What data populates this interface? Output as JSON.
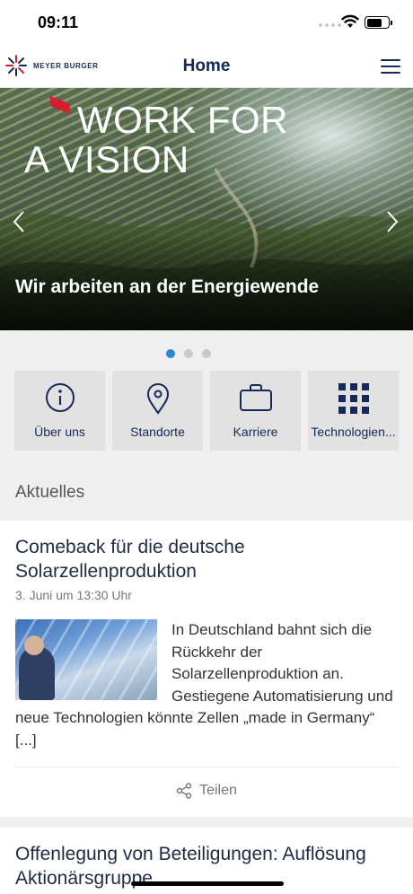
{
  "status_bar": {
    "time": "09:11"
  },
  "header": {
    "logo_text": "MEYER BURGER",
    "title": "Home"
  },
  "hero": {
    "headline_line1": "WORK FOR",
    "headline_line2": "A VISION",
    "caption": "Wir arbeiten an der Energiewende",
    "slide_count": 3,
    "active_slide": 1
  },
  "tiles": [
    {
      "label": "Über uns",
      "icon": "info-icon"
    },
    {
      "label": "Standorte",
      "icon": "location-pin-icon"
    },
    {
      "label": "Karriere",
      "icon": "briefcase-icon"
    },
    {
      "label": "Technologien...",
      "icon": "grid-icon"
    }
  ],
  "news": {
    "section_title": "Aktuelles",
    "items": [
      {
        "title": "Comeback für die deutsche Solarzellenproduktion",
        "date": "3. Juni um 13:30 Uhr",
        "excerpt": "In Deutschland bahnt sich die Rückkehr der Solarzellenproduktion an. Gestiegene Automatisierung und neue Technologien könnte Zellen „made in Germany“ [...]",
        "share_label": "Teilen"
      },
      {
        "title": "Offenlegung von Beteiligungen: Auflösung Aktionärsgruppe"
      }
    ]
  },
  "colors": {
    "brand_navy": "#16275a",
    "dot_active": "#2f86d6",
    "accent_red": "#d4202c"
  }
}
